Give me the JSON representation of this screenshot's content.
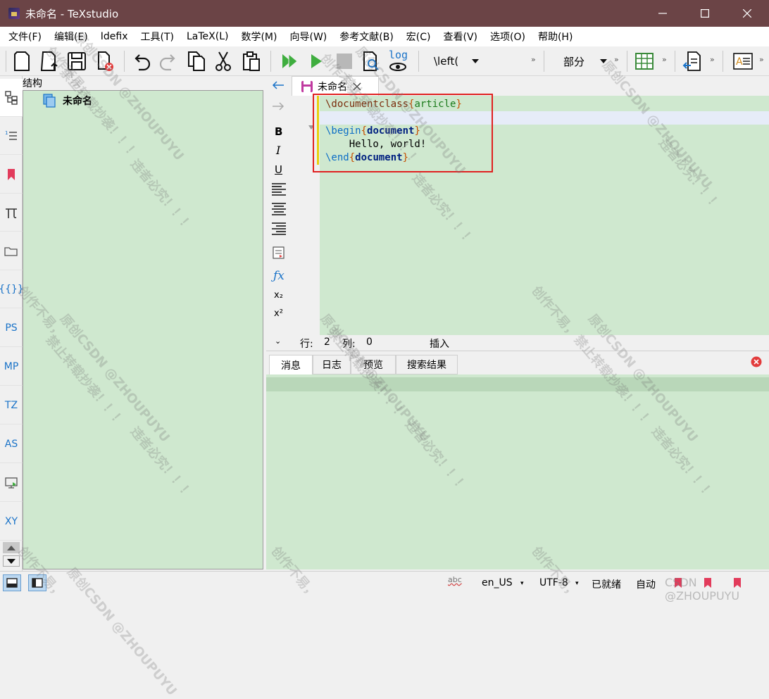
{
  "window": {
    "title": "未命名 - TeXstudio"
  },
  "menu": [
    "文件(F)",
    "编辑(E)",
    "Idefix",
    "工具(T)",
    "LaTeX(L)",
    "数学(M)",
    "向导(W)",
    "参考文献(B)",
    "宏(C)",
    "查看(V)",
    "选项(O)",
    "帮助(H)"
  ],
  "toolbar": {
    "left_combo": "\\left(",
    "section_combo": "部分",
    "log_label": "log",
    "overflow": "»"
  },
  "sidebar": {
    "items": [
      "PS",
      "MP",
      "TZ",
      "AS",
      "XY"
    ]
  },
  "structure": {
    "label": "结构",
    "root": "未命名"
  },
  "format": {
    "bold": "B",
    "italic": "I",
    "underline": "U",
    "subscript": "x₂",
    "superscript": "x²",
    "fx": "ƒx"
  },
  "editor": {
    "tab_title": "未命名",
    "lines": [
      {
        "cmd": "\\documentclass",
        "open": "{",
        "arg": "article",
        "close": "}"
      },
      {
        "text": ""
      },
      {
        "cmd": "\\begin",
        "open": "{",
        "arg": "document",
        "close": "}"
      },
      {
        "text": "    Hello, world!"
      },
      {
        "cmd": "\\end",
        "open": "{",
        "arg": "document",
        "close": "}"
      }
    ]
  },
  "position": {
    "row_label": "行:",
    "row": "2",
    "col_label": "列:",
    "col": "0",
    "mode": "插入"
  },
  "bottom_tabs": [
    "消息",
    "日志",
    "预览",
    "搜索结果"
  ],
  "statusbar": {
    "spell": "abc",
    "language": "en_US",
    "encoding": "UTF-8",
    "status": "已就绪",
    "auto": "自动"
  },
  "watermark": {
    "lines": [
      "创作不易，",
      "原创CSDN @ZHOUPUYU",
      "禁止转载抄袭！！！",
      "违者必究！！！"
    ],
    "footer": "CSDN @ZHOUPUYU"
  },
  "colors": {
    "titlebar": "#6b4446",
    "panel_bg": "#cfe8cf",
    "highlight_box": "#e02020",
    "accent": "#1a73c8"
  }
}
